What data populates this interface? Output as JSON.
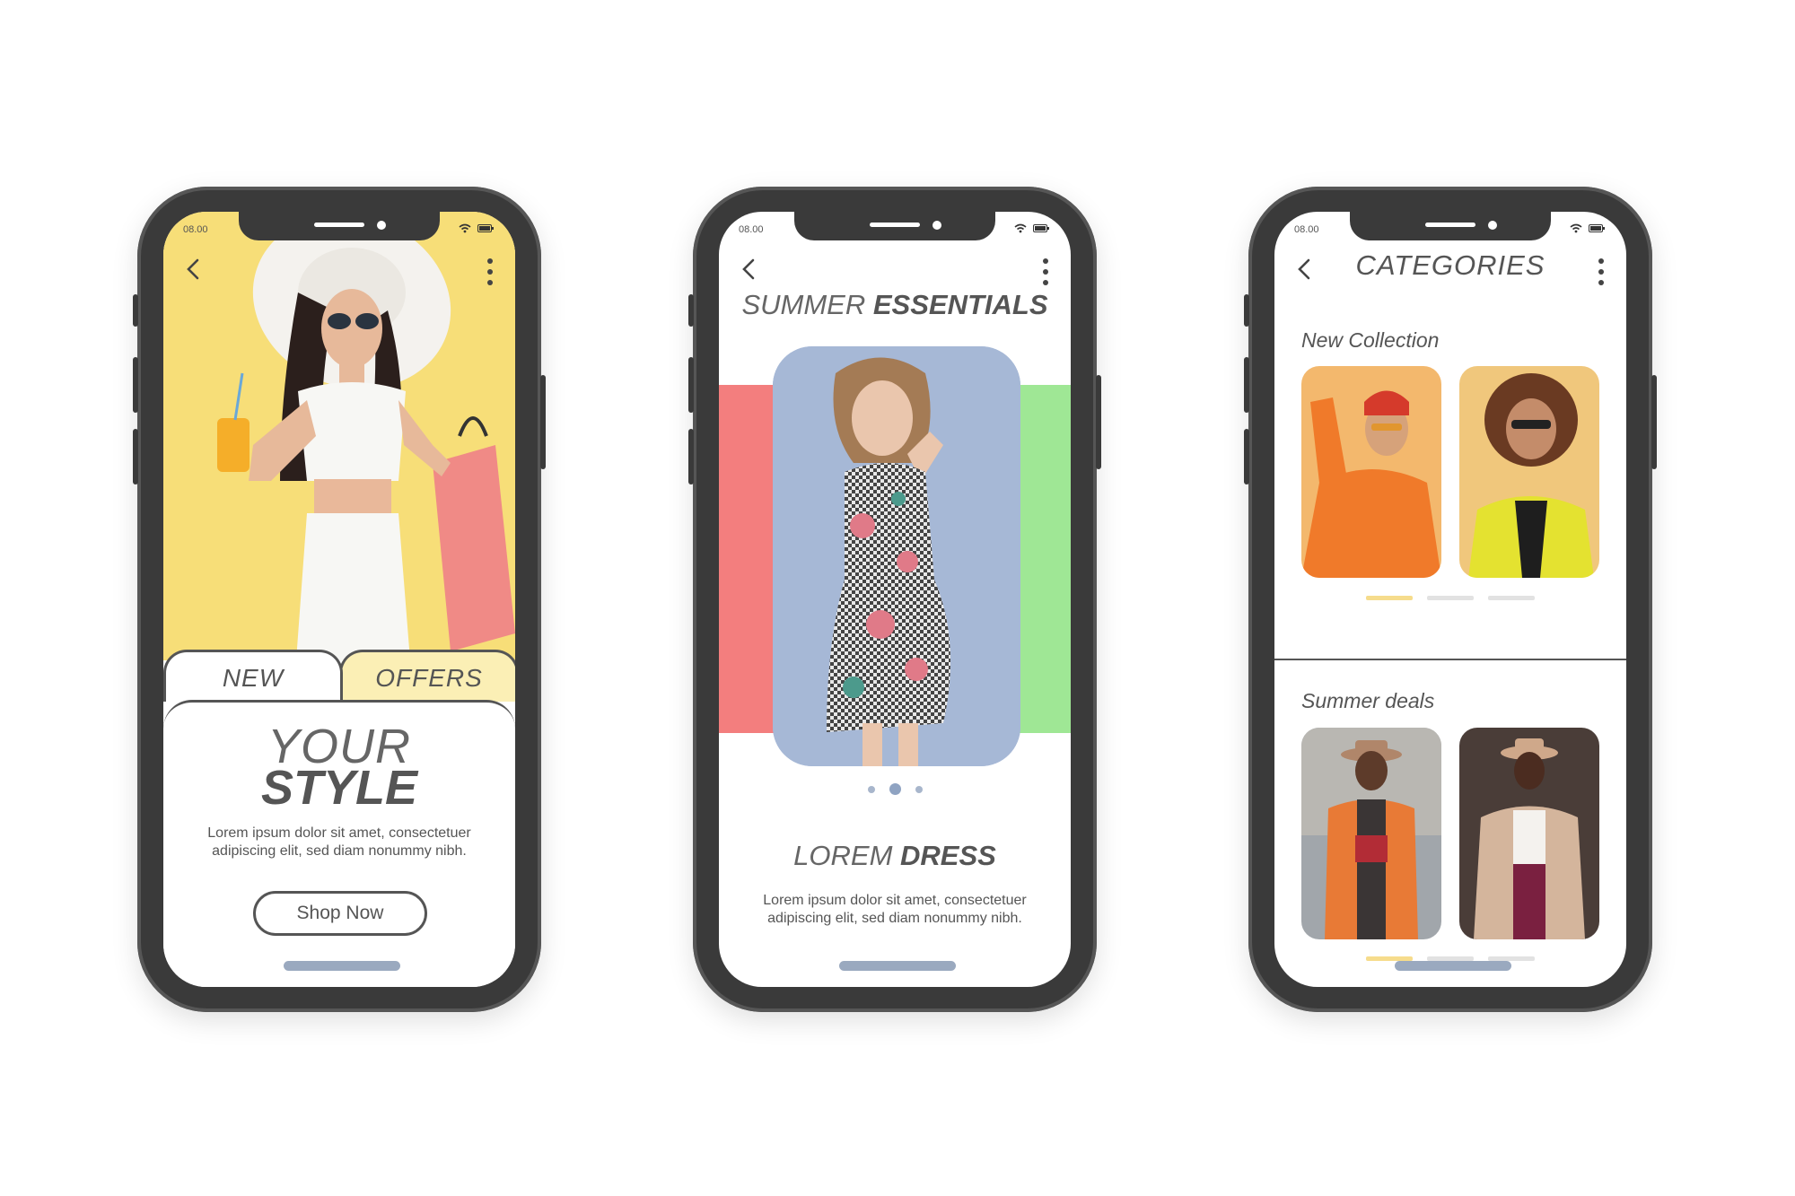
{
  "phones": [
    {
      "status_time": "08.00",
      "tabs": [
        "NEW",
        "OFFERS"
      ],
      "heading_light": "YOUR",
      "heading_bold": "STYLE",
      "description": "Lorem ipsum dolor sit amet, consectetuer adipiscing elit, sed diam nonummy nibh.",
      "cta_label": "Shop Now",
      "hero_bg": "#f7de78"
    },
    {
      "status_time": "08.00",
      "title_light": "SUMMER",
      "title_bold": "ESSENTIALS",
      "product_light": "LOREM",
      "product_bold": "DRESS",
      "description": "Lorem ipsum dolor sit amet, consectetuer adipiscing elit, sed diam nonummy nibh.",
      "carousel_active_index": 1,
      "carousel_count": 3,
      "accent_left": "#f37e7e",
      "accent_right": "#9fe795"
    },
    {
      "status_time": "08.00",
      "title": "CATEGORIES",
      "sections": [
        {
          "title": "New Collection",
          "pager_active": 0,
          "pager_count": 3
        },
        {
          "title": "Summer deals",
          "pager_active": 0,
          "pager_count": 3
        }
      ],
      "pager_color": "#f6dc8c"
    }
  ],
  "icons": {
    "back": "chevron-left-icon",
    "more": "more-vertical-icon",
    "wifi": "wifi-icon",
    "battery": "battery-icon"
  }
}
